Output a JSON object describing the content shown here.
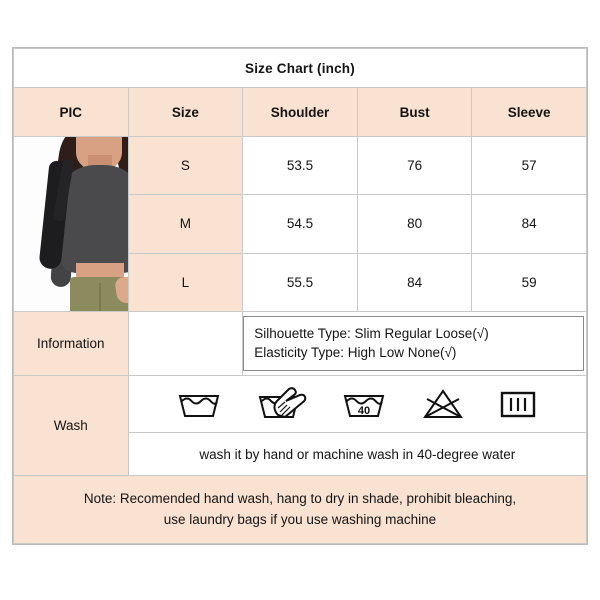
{
  "title": "Size Chart (inch)",
  "columns": [
    "PIC",
    "Size",
    "Shoulder",
    "Bust",
    "Sleeve"
  ],
  "rows": [
    {
      "size": "S",
      "shoulder": "53.5",
      "bust": "76",
      "sleeve": "57"
    },
    {
      "size": "M",
      "shoulder": "54.5",
      "bust": "80",
      "sleeve": "84"
    },
    {
      "size": "L",
      "shoulder": "55.5",
      "bust": "84",
      "sleeve": "59"
    }
  ],
  "information": {
    "label": "Information",
    "line1": "Silhouette Type: Slim  Regular  Loose(√)",
    "line2": "Elasticity Type: High  Low  None(√)"
  },
  "wash": {
    "label": "Wash",
    "instruction": "wash it by hand or machine wash in 40-degree water",
    "icons": [
      {
        "name": "machine-wash-icon",
        "temp": ""
      },
      {
        "name": "hand-wash-icon",
        "temp": ""
      },
      {
        "name": "wash-40-degrees-icon",
        "temp": "40"
      },
      {
        "name": "do-not-bleach-icon",
        "temp": ""
      },
      {
        "name": "drip-dry-icon",
        "temp": ""
      }
    ]
  },
  "note": {
    "line1": "Note: Recomended hand wash, hang to dry in shade, prohibit bleaching,",
    "line2": "use laundry bags if you use washing machine"
  },
  "colors": {
    "peach": "#f9e2d2",
    "border": "#c9c9c9",
    "text": "#141414"
  },
  "product_image": {
    "alt": "Woman wearing dark gray long sleeve fitted top with olive cargo pants and black shoulder bag"
  }
}
